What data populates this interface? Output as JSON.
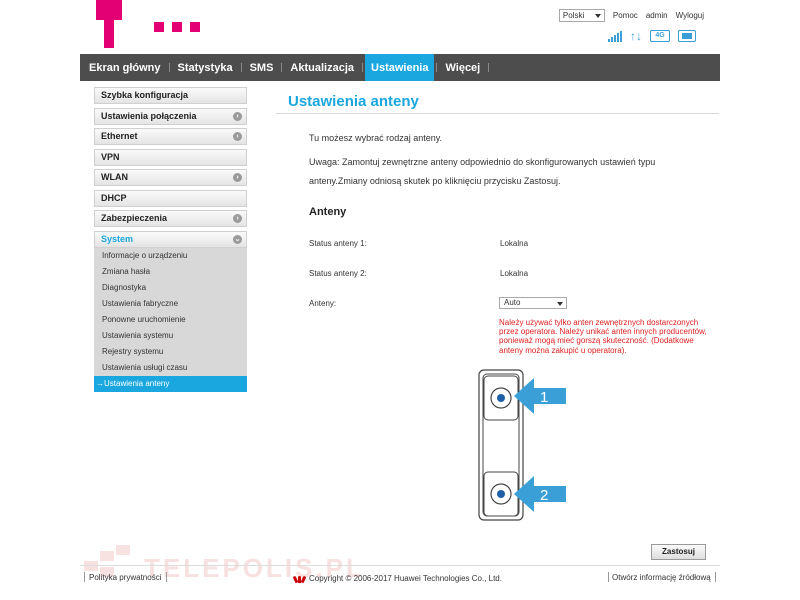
{
  "header": {
    "language": "Polski",
    "links": {
      "help": "Pomoc",
      "admin": "admin",
      "logout": "Wyloguj"
    },
    "status_icons": [
      "signal-icon",
      "data-transfer-icon",
      "network-4g-icon",
      "sim-card-icon"
    ],
    "network_badge": "4G"
  },
  "nav": {
    "items": [
      {
        "label": "Ekran główny",
        "active": false
      },
      {
        "label": "Statystyka",
        "active": false
      },
      {
        "label": "SMS",
        "active": false
      },
      {
        "label": "Aktualizacja",
        "active": false
      },
      {
        "label": "Ustawienia",
        "active": true
      },
      {
        "label": "Więcej",
        "active": false
      }
    ]
  },
  "sidebar": {
    "items": [
      {
        "label": "Szybka konfiguracja",
        "expandable": false
      },
      {
        "label": "Ustawienia połączenia",
        "expandable": true
      },
      {
        "label": "Ethernet",
        "expandable": true
      },
      {
        "label": "VPN",
        "expandable": false
      },
      {
        "label": "WLAN",
        "expandable": true
      },
      {
        "label": "DHCP",
        "expandable": false
      },
      {
        "label": "Zabezpieczenia",
        "expandable": true
      }
    ],
    "system": {
      "label": "System",
      "subitems": [
        "Informacje o urządzeniu",
        "Zmiana hasła",
        "Diagnostyka",
        "Ustawienia fabryczne",
        "Ponowne uruchomienie",
        "Ustawienia systemu",
        "Rejestry systemu",
        "Ustawienia usługi czasu"
      ],
      "active_item": "→Ustawienia anteny"
    }
  },
  "main": {
    "title": "Ustawienia anteny",
    "intro": "Tu możesz wybrać rodzaj anteny.",
    "note_line1": "Uwaga: Zamontuj zewnętrzne anteny odpowiednio do skonfigurowanych ustawień typu",
    "note_line2": "anteny.Zmiany odniosą skutek po kliknięciu przycisku Zastosuj.",
    "section_title": "Anteny",
    "antenna1_label": "Status anteny 1:",
    "antenna1_value": "Lokalna",
    "antenna2_label": "Status anteny 2:",
    "antenna2_value": "Lokalna",
    "antennas_label": "Anteny:",
    "antennas_selected": "Auto",
    "warning": "Należy używać tylko anten zewnętrznych dostarczonych przez operatora. Należy unikać anten innych producentów, ponieważ mogą mieć gorszą skuteczność. (Dodatkowe anteny można zakupić u operatora).",
    "diagram_label_1": "1",
    "diagram_label_2": "2",
    "apply_label": "Zastosuj"
  },
  "footer": {
    "privacy": "Polityka prywatności",
    "copyright": "Copyright © 2006-2017 Huawei Technologies Co., Ltd.",
    "open_source": "Otwórz informację źródłową"
  },
  "watermark": "TELEPOLIS.PL",
  "colors": {
    "brand_magenta": "#e20074",
    "accent_blue": "#1aa7e0",
    "nav_bg": "#4d4d4d",
    "warning_red": "#e02020",
    "arrow_blue": "#3a9fd6"
  }
}
